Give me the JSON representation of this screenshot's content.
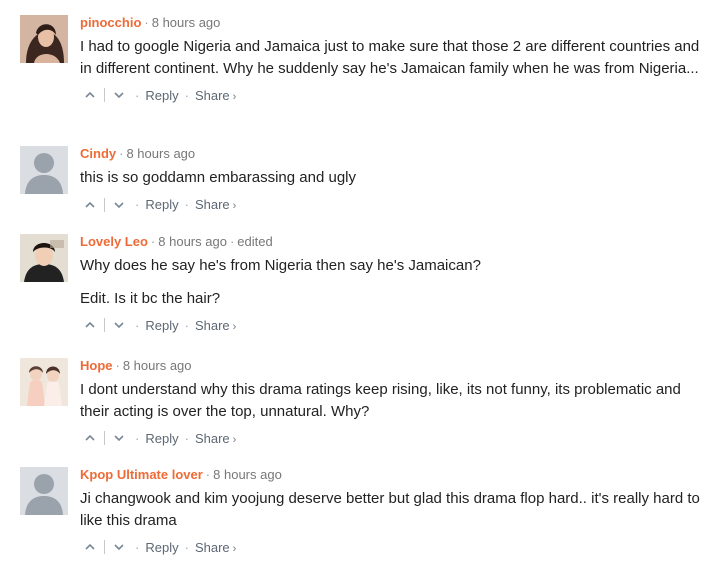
{
  "actions": {
    "reply_label": "Reply",
    "share_label": "Share",
    "share_chevron": "›"
  },
  "comments": [
    {
      "author": "pinocchio",
      "time": "8 hours ago",
      "edited": "",
      "avatar": "photo-portrait",
      "text": "I had to google Nigeria and Jamaica just to make sure that those 2 are different countries and in different continent. Why he suddenly say he's Jamaican family when he was from Nigeria...",
      "text2": ""
    },
    {
      "author": "Cindy",
      "time": "8 hours ago",
      "edited": "",
      "avatar": "default-avatar",
      "text": "this is so goddamn embarassing and ugly",
      "text2": ""
    },
    {
      "author": "Lovely Leo",
      "time": "8 hours ago",
      "edited": "edited",
      "avatar": "photo-portrait",
      "text": "Why does he say he's from Nigeria then say he's Jamaican?",
      "text2": "Edit. Is it bc the hair?"
    },
    {
      "author": "Hope",
      "time": "8 hours ago",
      "edited": "",
      "avatar": "photo-group",
      "text": "I dont understand why this drama ratings keep rising, like, its not funny, its problematic and their acting is over the top, unnatural. Why?",
      "text2": ""
    },
    {
      "author": "Kpop Ultimate lover",
      "time": "8 hours ago",
      "edited": "",
      "avatar": "default-avatar",
      "text": "Ji changwook and kim yoojung deserve better but glad this drama flop hard.. it's really hard to like this drama",
      "text2": ""
    }
  ]
}
